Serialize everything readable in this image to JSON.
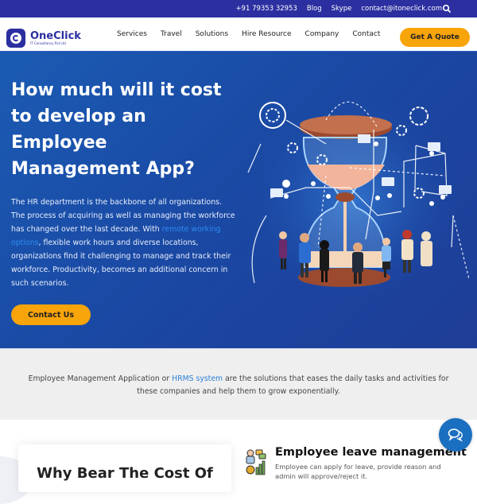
{
  "topbar": {
    "phone": "+91 79353 32953",
    "blog": "Blog",
    "skype": "Skype",
    "email": "contact@itoneclick.com",
    "search_icon": "search-icon"
  },
  "header": {
    "logo": {
      "name": "OneClick",
      "tagline": "IT Consultancy Pvt Ltd"
    },
    "nav": [
      "Services",
      "Travel",
      "Solutions",
      "Hire Resource",
      "Company",
      "Contact"
    ],
    "cta_label": "Get A Quote"
  },
  "hero": {
    "title": "How much will it cost to develop an Employee Management App?",
    "paragraph_before_link": "The HR department is the backbone of all organizations. The process of acquiring as well as managing the workforce has changed over the last decade. With ",
    "paragraph_link": "remote working options",
    "paragraph_after_link": ", flexible work hours and diverse locations, organizations find it challenging to manage and track their workforce. Productivity, becomes an additional concern in such scenarios.",
    "button_label": "Contact Us",
    "illustration": "hourglass-team-network-illustration"
  },
  "intro": {
    "text_before_link": "Employee Management Application or ",
    "link": "HRMS system",
    "text_after_link": " are the solutions that eases the daily tasks and activities for these companies and help them to grow exponentially."
  },
  "lower": {
    "card_heading": "Why Bear The Cost Of",
    "feature": {
      "icon": "employee-leave-icon",
      "title": "Employee leave management",
      "description": "Employee can apply for leave, provide reason and admin will approve/reject it."
    }
  },
  "chat": {
    "icon": "chat-bubbles-icon"
  },
  "colors": {
    "topbar": "#2b2fa0",
    "accent": "#f8a40b",
    "hero_blue": "#1b4fa8",
    "link_blue": "#2b8cf2",
    "chat_blue": "#1a6fc0"
  }
}
